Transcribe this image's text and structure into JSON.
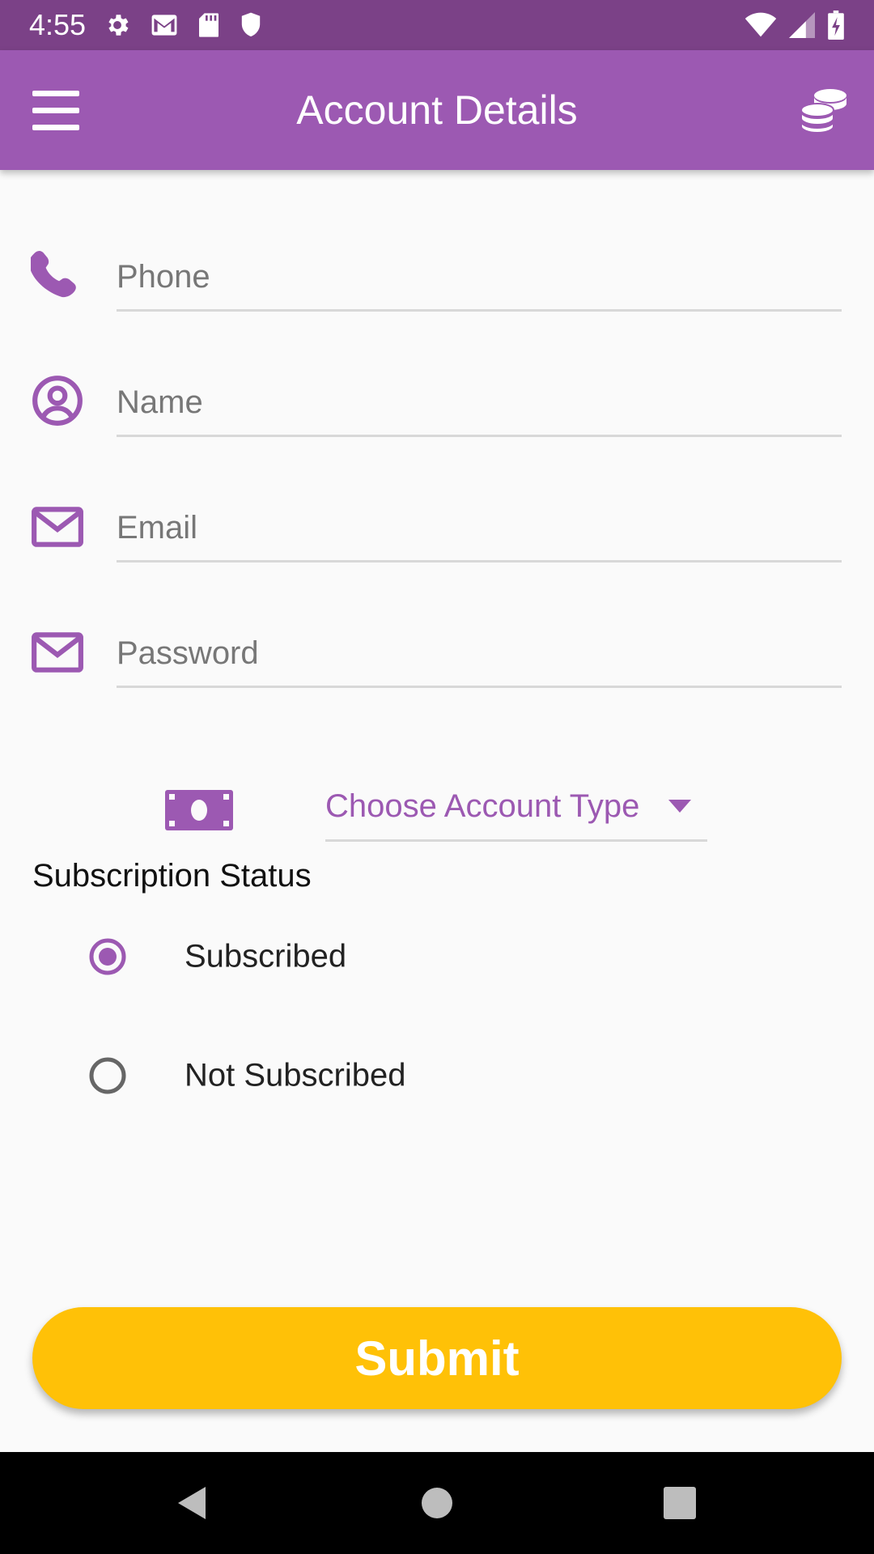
{
  "status_bar": {
    "time": "4:55",
    "left_icons": [
      "gear-icon",
      "gmail-icon",
      "sd-card-icon",
      "shield-icon"
    ],
    "right_icons": [
      "wifi-icon",
      "signal-icon",
      "battery-charging-icon"
    ]
  },
  "app_bar": {
    "title": "Account Details",
    "left_icon": "menu-icon",
    "right_icon": "coins-icon"
  },
  "form": {
    "fields": [
      {
        "icon": "phone-icon",
        "placeholder": "Phone",
        "value": ""
      },
      {
        "icon": "user-circle-icon",
        "placeholder": "Name",
        "value": ""
      },
      {
        "icon": "envelope-icon",
        "placeholder": "Email",
        "value": ""
      },
      {
        "icon": "envelope-icon",
        "placeholder": "Password",
        "value": ""
      }
    ],
    "account_type": {
      "icon": "money-bill-icon",
      "label": "Choose Account Type"
    },
    "subscription": {
      "label": "Subscription Status",
      "options": [
        {
          "label": "Subscribed",
          "selected": true
        },
        {
          "label": "Not Subscribed",
          "selected": false
        }
      ]
    },
    "submit_label": "Submit"
  },
  "colors": {
    "status_bar": "#7b4187",
    "primary": "#9c59b2",
    "accent": "#ffc107",
    "background": "#fafafa"
  },
  "nav_bar": {
    "icons": [
      "back-icon",
      "home-icon",
      "recents-icon"
    ]
  }
}
